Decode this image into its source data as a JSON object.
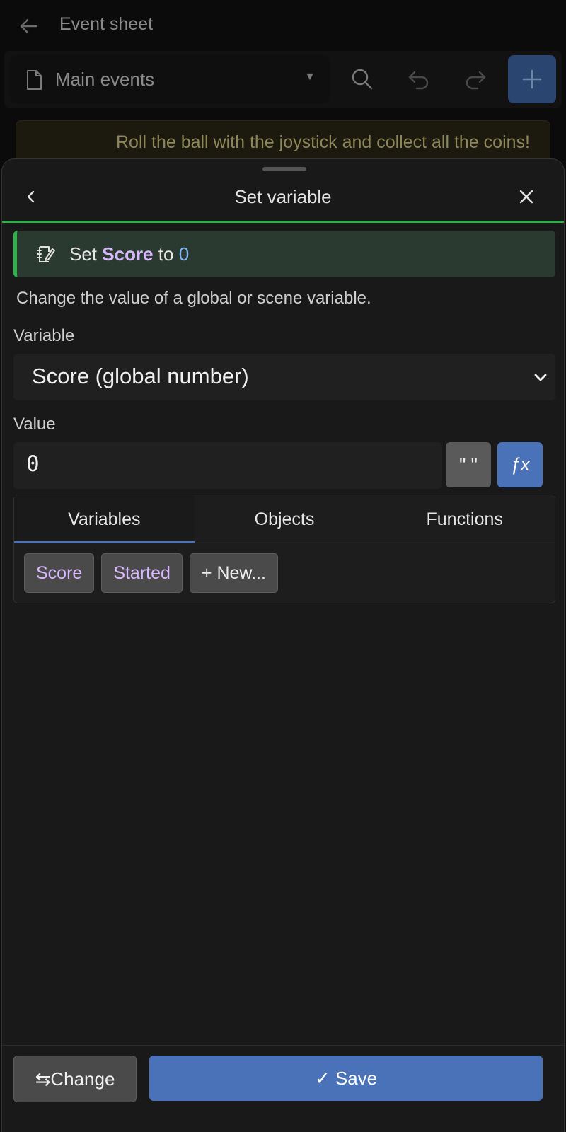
{
  "app": {
    "title": "Event sheet",
    "sheet_select": "Main events",
    "banner": "Roll the ball with the joystick and collect all the coins!"
  },
  "dialog": {
    "title": "Set variable",
    "summary": {
      "prefix": "Set",
      "variable": "Score",
      "middle": "to",
      "value": "0"
    },
    "description": "Change the value of a global or scene variable.",
    "variable_label": "Variable",
    "variable_value": "Score (global number)",
    "value_label": "Value",
    "value_input": "0",
    "quote_button": "\" \"",
    "fx_button": "ƒx",
    "tabs": [
      {
        "label": "Variables",
        "active": true
      },
      {
        "label": "Objects",
        "active": false
      },
      {
        "label": "Functions",
        "active": false
      }
    ],
    "chips": [
      "Score",
      "Started"
    ],
    "new_chip": "+  New...",
    "change_button": "⇆Change",
    "save_button": "✓ Save"
  },
  "colors": {
    "accent_green": "#2bb34a",
    "accent_blue": "#4a72b8",
    "variable_purple": "#d8b9ff",
    "value_blue": "#7fb6ff"
  },
  "icons": [
    "back-arrow-icon",
    "file-icon",
    "dropdown-caret-icon",
    "search-icon",
    "undo-icon",
    "redo-icon",
    "plus-icon",
    "chevron-left-icon",
    "close-icon",
    "edit-note-icon",
    "chevron-down-icon"
  ]
}
